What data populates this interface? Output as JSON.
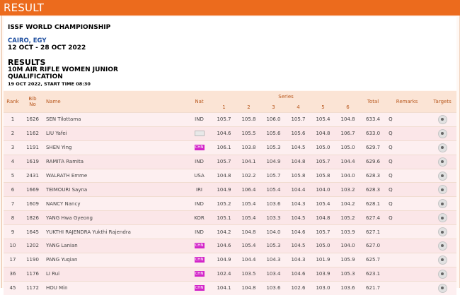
{
  "header": {
    "title": "RESULT"
  },
  "info": {
    "championship": "ISSF WORLD CHAMPIONSHIP",
    "location": "CAIRO, EGY",
    "dates": "12 OCT - 28 OCT 2022",
    "results_title": "RESULTS",
    "event_line1": "10M AIR RIFLE WOMEN JUNIOR",
    "event_line2": "QUALIFICATION",
    "start": "19 OCT 2022, START TIME 08:30"
  },
  "table": {
    "headers": {
      "rank": "Rank",
      "bib": "Bib",
      "bib2": "No",
      "name": "Name",
      "nat": "Nat",
      "series": "Series",
      "s": [
        "1",
        "2",
        "3",
        "4",
        "5",
        "6"
      ],
      "total": "Total",
      "remarks": "Remarks",
      "targets": "Targets"
    },
    "rows": [
      {
        "rank": "1",
        "bib": "1626",
        "name": "SEN Tilottama",
        "nat": "IND",
        "flag": "",
        "s": [
          "105.7",
          "105.8",
          "106.0",
          "105.7",
          "105.4",
          "104.8"
        ],
        "total": "633.4",
        "remarks": "Q"
      },
      {
        "rank": "2",
        "bib": "1162",
        "name": "LIU Yafei",
        "nat": "",
        "flag": "box",
        "s": [
          "104.6",
          "105.5",
          "105.6",
          "105.6",
          "104.8",
          "106.7"
        ],
        "total": "633.0",
        "remarks": "Q"
      },
      {
        "rank": "3",
        "bib": "1191",
        "name": "SHEN Ying",
        "nat": "CHN",
        "flag": "chn",
        "s": [
          "106.1",
          "103.8",
          "105.3",
          "104.5",
          "105.0",
          "105.0"
        ],
        "total": "629.7",
        "remarks": "Q"
      },
      {
        "rank": "4",
        "bib": "1619",
        "name": "RAMITA Ramita",
        "nat": "IND",
        "flag": "",
        "s": [
          "105.7",
          "104.1",
          "104.9",
          "104.8",
          "105.7",
          "104.4"
        ],
        "total": "629.6",
        "remarks": "Q"
      },
      {
        "rank": "5",
        "bib": "2431",
        "name": "WALRATH Emme",
        "nat": "USA",
        "flag": "",
        "s": [
          "104.8",
          "102.2",
          "105.7",
          "105.8",
          "105.8",
          "104.0"
        ],
        "total": "628.3",
        "remarks": "Q"
      },
      {
        "rank": "6",
        "bib": "1669",
        "name": "TEIMOURI Sayna",
        "nat": "IRI",
        "flag": "",
        "s": [
          "104.9",
          "106.4",
          "105.4",
          "104.4",
          "104.0",
          "103.2"
        ],
        "total": "628.3",
        "remarks": "Q"
      },
      {
        "rank": "7",
        "bib": "1609",
        "name": "NANCY Nancy",
        "nat": "IND",
        "flag": "",
        "s": [
          "105.2",
          "105.4",
          "103.6",
          "104.3",
          "105.4",
          "104.2"
        ],
        "total": "628.1",
        "remarks": "Q"
      },
      {
        "rank": "8",
        "bib": "1826",
        "name": "YANG Hwa Gyeong",
        "nat": "KOR",
        "flag": "",
        "s": [
          "105.1",
          "105.4",
          "103.3",
          "104.5",
          "104.8",
          "105.2"
        ],
        "total": "627.4",
        "remarks": "Q"
      },
      {
        "rank": "9",
        "bib": "1645",
        "name": "YUKTHI RAJENDRA Yukthi Rajendra",
        "nat": "IND",
        "flag": "",
        "s": [
          "104.2",
          "104.8",
          "104.0",
          "104.6",
          "105.7",
          "103.9"
        ],
        "total": "627.1",
        "remarks": ""
      },
      {
        "rank": "10",
        "bib": "1202",
        "name": "YANG Lanian",
        "nat": "CHN",
        "flag": "chn",
        "s": [
          "104.6",
          "105.4",
          "105.3",
          "104.5",
          "105.0",
          "104.0"
        ],
        "total": "627.0",
        "remarks": ""
      },
      {
        "rank": "17",
        "bib": "1190",
        "name": "PANG Yuqian",
        "nat": "CHN",
        "flag": "chn",
        "s": [
          "104.9",
          "104.4",
          "104.3",
          "104.3",
          "101.9",
          "105.9"
        ],
        "total": "625.7",
        "remarks": ""
      },
      {
        "rank": "36",
        "bib": "1176",
        "name": "LI Rui",
        "nat": "CHN",
        "flag": "chn",
        "s": [
          "102.4",
          "103.5",
          "103.4",
          "104.6",
          "103.9",
          "105.3"
        ],
        "total": "623.1",
        "remarks": ""
      },
      {
        "rank": "45",
        "bib": "1172",
        "name": "HOU Min",
        "nat": "CHN",
        "flag": "chn",
        "s": [
          "104.1",
          "104.8",
          "103.6",
          "102.6",
          "103.0",
          "103.6"
        ],
        "total": "621.7",
        "remarks": ""
      }
    ]
  },
  "icons": {
    "target": "target-icon"
  },
  "colors": {
    "accent": "#ec6b1d",
    "header_bg": "#fbe4d5",
    "header_text": "#b8581e",
    "row_bg": "#fdeff0",
    "chn_flag": "#d326c9"
  }
}
